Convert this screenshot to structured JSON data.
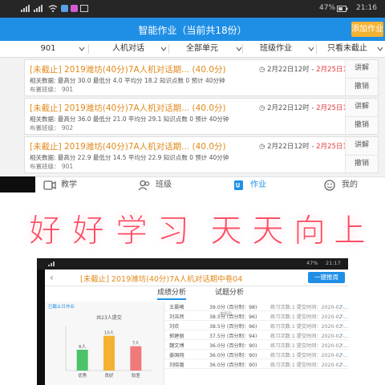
{
  "shot1": {
    "status": {
      "left_icons": [
        "signal-icon",
        "signal-icon",
        "wifi-icon",
        "app-icon",
        "app-icon",
        "image-icon"
      ],
      "battery": "47%",
      "time": "21:16"
    },
    "title": "智能作业（当前共18份）",
    "add_button": "添加作业",
    "filters": [
      "901",
      "人机对话",
      "全部单元",
      "班级作业",
      "只看未截止"
    ],
    "cards": [
      {
        "tag": "[未截止]",
        "name": "2019潍坊(40分)7A人机对话期...",
        "score": "(40.0分)",
        "start": "2月22日12时",
        "sep": " - ",
        "due": "2月25日12时",
        "stats": "相关数据:    最高分 30.0    最低分 4.0    平均分 18.2    知识点数 0    预计 40分钟",
        "reviewer": "布置班级：  901",
        "btn1": "讲解",
        "btn2": "撤销"
      },
      {
        "tag": "[未截止]",
        "name": "2019潍坊(40分)7A人机对话期...",
        "score": "(40.0分)",
        "start": "2月22日12时",
        "sep": " - ",
        "due": "2月25日12时",
        "stats": "相关数据:    最高分 36.0    最低分 21.0    平均分 29.1    知识点数 0    预计 40分钟",
        "reviewer": "布置班级：  902",
        "btn1": "讲解",
        "btn2": "撤销"
      },
      {
        "tag": "[未截止]",
        "name": "2019潍坊(40分)7A人机对话期...",
        "score": "(40.0分)",
        "start": "2月22日12时",
        "sep": " - ",
        "due": "2月25日12时",
        "stats": "相关数据:    最高分 22.9    最低分 14.5    平均分 22.9    知识点数 0    预计 40分钟",
        "reviewer": "布置班级：  901",
        "btn1": "讲解",
        "btn2": "撤销"
      }
    ],
    "tabs": [
      {
        "label": "教学",
        "icon": "video-icon"
      },
      {
        "label": "班级",
        "icon": "people-icon"
      },
      {
        "label": "作业",
        "icon": "homework-icon",
        "active": true
      },
      {
        "label": "我的",
        "icon": "smile-icon"
      }
    ]
  },
  "banner": [
    "好",
    "好",
    "学",
    "习",
    "天",
    "天",
    "向",
    "上"
  ],
  "shot2": {
    "status": {
      "battery": "47%",
      "time": "21:17"
    },
    "title": "[未截止] 2019潍坊(40分)7A人机对话期中卷04",
    "onekey": "一键推周",
    "tabs": [
      "成绩分析",
      "试题分析"
    ],
    "tab_small": "按题型",
    "chart_header": "已截止日作业",
    "chart_data": {
      "type": "bar",
      "title": "共23人提交",
      "categories": [
        "优秀",
        "良好",
        "较差"
      ],
      "values": [
        6,
        10,
        7
      ],
      "value_labels": [
        "6人",
        "10人",
        "7人"
      ],
      "colors": [
        "#4cc36b",
        "#f4b233",
        "#f07a7a"
      ],
      "ylim": [
        0,
        12
      ]
    },
    "rows": [
      {
        "name": "王晨曦",
        "score": "39.0分 (百分制：98)",
        "extra": "练习次数:1  提交时间：2020-02-..."
      },
      {
        "name": "刘浩然",
        "score": "38.5分 (百分制：96)",
        "extra": "练习次数:1  提交时间：2020-02-..."
      },
      {
        "name": "刘欢",
        "score": "38.5分 (百分制：96)",
        "extra": "练习次数:1  提交时间：2020-02-..."
      },
      {
        "name": "郭建丽",
        "score": "37.5分 (百分制：94)",
        "extra": "练习次数:1  提交时间：2020-02-..."
      },
      {
        "name": "魏文博",
        "score": "36.0分 (百分制：90)",
        "extra": "练习次数:1  提交时间：2020-02-..."
      },
      {
        "name": "姜国翔",
        "score": "36.0分 (百分制：90)",
        "extra": "练习次数:1  提交时间：2020-02-..."
      },
      {
        "name": "刘晓璐",
        "score": "36.0分 (百分制：90)",
        "extra": "练习次数:1  提交时间：2020-02-..."
      }
    ]
  }
}
